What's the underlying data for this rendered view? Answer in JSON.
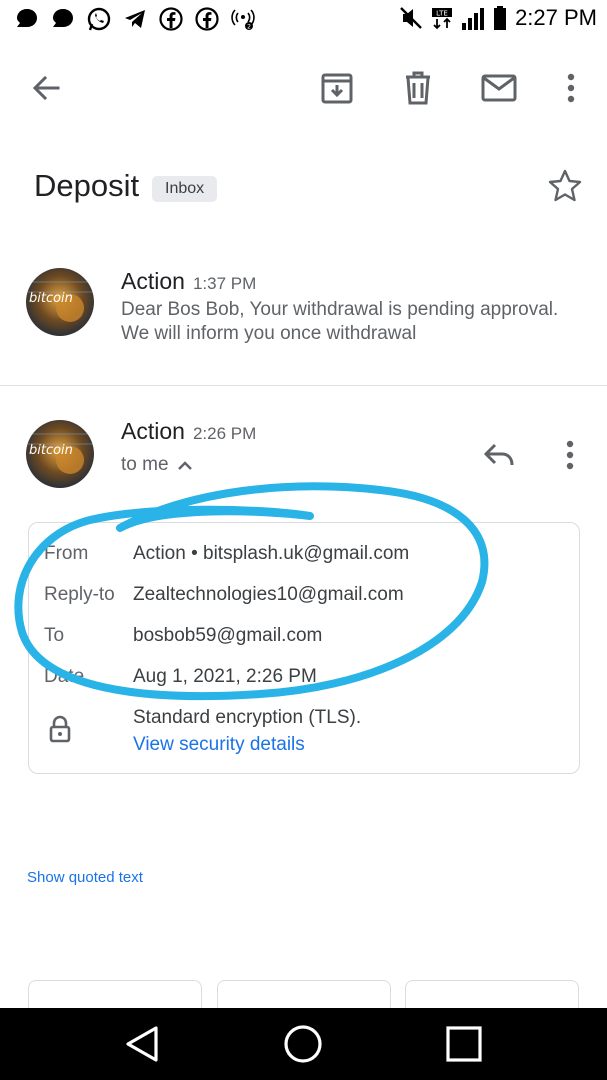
{
  "status_bar": {
    "time": "2:27 PM",
    "icons_left": [
      "chat-bubble-icon",
      "chat-bubble-icon",
      "whatsapp-icon",
      "telegram-icon",
      "facebook-icon",
      "facebook-icon",
      "hotspot-icon"
    ],
    "icons_right": [
      "mute-icon",
      "lte-icon",
      "signal-icon",
      "battery-icon"
    ]
  },
  "toolbar": {
    "back_icon": "arrow-back-icon",
    "archive_icon": "archive-icon",
    "delete_icon": "trash-icon",
    "mark_unread_icon": "mail-icon",
    "more_icon": "more-vert-icon"
  },
  "subject": {
    "title": "Deposit",
    "label": "Inbox"
  },
  "messages": [
    {
      "sender": "Action",
      "time": "1:37 PM",
      "snippet": "Dear Bos Bob, Your withdrawal is pending approval. We will inform you once withdrawal",
      "avatar_text": "bitcoin"
    },
    {
      "sender": "Action",
      "time": "2:26 PM",
      "recipient_summary": "to me",
      "avatar_text": "bitcoin"
    }
  ],
  "details": {
    "from_label": "From",
    "from_value": "Action • bitsplash.uk@gmail.com",
    "replyto_label": "Reply-to",
    "replyto_value": "Zealtechnologies10@gmail.com",
    "to_label": "To",
    "to_value": "bosbob59@gmail.com",
    "date_label": "Date",
    "date_value": "Aug 1, 2021, 2:26 PM",
    "encryption": "Standard encryption (TLS).",
    "security_link": "View security details"
  },
  "quoted_link": "Show quoted text",
  "colors": {
    "link": "#1a73e8",
    "annotation": "#2ab3e6",
    "navbar": "#000000"
  }
}
